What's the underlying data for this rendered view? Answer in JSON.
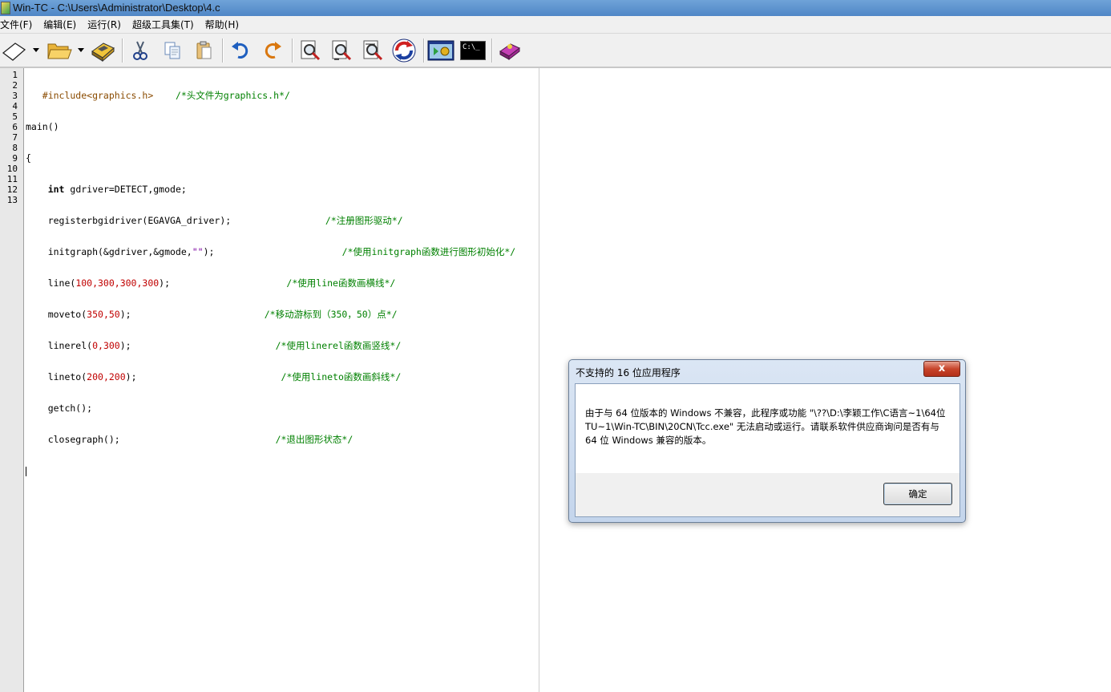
{
  "window": {
    "title": "Win-TC - C:\\Users\\Administrator\\Desktop\\4.c"
  },
  "menu": {
    "items": [
      {
        "label": "文件(F)"
      },
      {
        "label": "编辑(E)"
      },
      {
        "label": "运行(R)"
      },
      {
        "label": "超级工具集(T)"
      },
      {
        "label": "帮助(H)"
      }
    ]
  },
  "toolbar": {
    "icons": [
      "new-file-icon",
      "open-folder-icon",
      "save-book-icon",
      "cut-icon",
      "copy-icon",
      "paste-icon",
      "undo-icon",
      "redo-icon",
      "find-icon",
      "find-next-icon",
      "replace-icon",
      "refresh-icon",
      "compile-run-icon",
      "console-icon",
      "help-book-icon"
    ],
    "console_label": "C:\\_"
  },
  "editor": {
    "line_numbers": [
      "1",
      "2",
      "3",
      "4",
      "5",
      "6",
      "7",
      "8",
      "9",
      "10",
      "11",
      "12",
      "13"
    ],
    "lines": {
      "l1a": "   #include<graphics.h>    ",
      "l1b": "/*头文件为graphics.h*/",
      "l2": "main()",
      "l3": "{",
      "l4a": "    ",
      "l4b": "int",
      "l4c": " gdriver=DETECT,gmode;",
      "l5a": "    registerbgidriver(EGAVGA_driver);                 ",
      "l5b": "/*注册图形驱动*/",
      "l6a": "    initgraph(&gdriver,&gmode,",
      "l6b": "\"\"",
      "l6c": ");                       ",
      "l6d": "/*使用initgraph函数进行图形初始化*/",
      "l7a": "    line(",
      "l7b": "100,300,300,300",
      "l7c": ");                     ",
      "l7d": "/*使用line函数画横线*/",
      "l8a": "    moveto(",
      "l8b": "350,50",
      "l8c": ");                        ",
      "l8d": "/*移动游标到（350，50）点*/",
      "l9a": "    linerel(",
      "l9b": "0,300",
      "l9c": ");                          ",
      "l9d": "/*使用linerel函数画竖线*/",
      "l10a": "    lineto(",
      "l10b": "200,200",
      "l10c": ");                          ",
      "l10d": "/*使用lineto函数画斜线*/",
      "l11": "    getch();",
      "l12a": "    closegraph();                            ",
      "l12b": "/*退出图形状态*/"
    }
  },
  "dialog": {
    "title": "不支持的 16 位应用程序",
    "close_label": "x",
    "message": "由于与 64 位版本的 Windows 不兼容，此程序或功能 \"\\??\\D:\\李颖工作\\C语言~1\\64位TU~1\\Win-TC\\BIN\\20CN\\Tcc.exe\" 无法启动或运行。请联系软件供应商询问是否有与 64 位 Windows 兼容的版本。",
    "ok_label": "确定"
  }
}
